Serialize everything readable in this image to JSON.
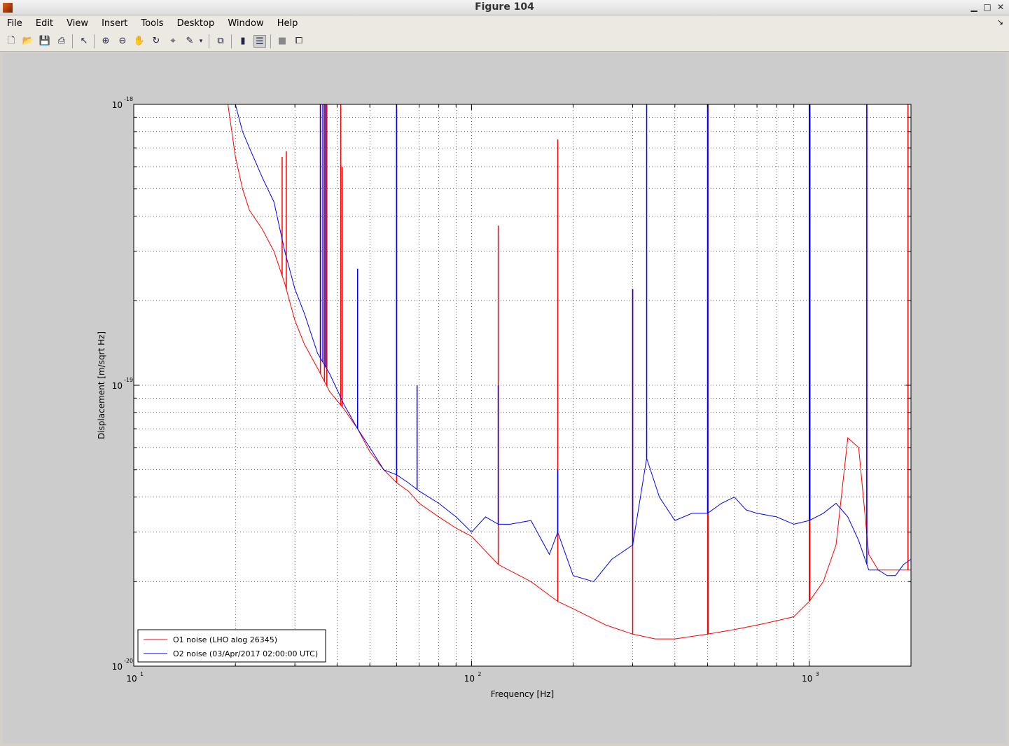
{
  "window": {
    "title": "Figure 104"
  },
  "menu": [
    "File",
    "Edit",
    "View",
    "Insert",
    "Tools",
    "Desktop",
    "Window",
    "Help"
  ],
  "toolbar": {
    "icons": [
      "new-figure-icon",
      "open-file-icon",
      "save-icon",
      "print-icon",
      "edit-plot-icon",
      "zoom-in-icon",
      "zoom-out-icon",
      "pan-icon",
      "rotate-icon",
      "data-cursor-icon",
      "brush-icon",
      "link-plot-icon",
      "colorbar-icon",
      "legend-icon",
      "hide-plot-tools-icon",
      "show-plot-tools-icon"
    ]
  },
  "chart_data": {
    "type": "line",
    "xlabel": "Frequency [Hz]",
    "ylabel": "Displacement [m/sqrt Hz]",
    "xscale": "log",
    "yscale": "log",
    "xlim": [
      10,
      2000
    ],
    "ylim": [
      1e-20,
      1e-18
    ],
    "grid": true,
    "legend_position": "bottom-left",
    "x_ticks": [
      {
        "value": 10,
        "base": "10",
        "exp": "1"
      },
      {
        "value": 100,
        "base": "10",
        "exp": "2"
      },
      {
        "value": 1000,
        "base": "10",
        "exp": "3"
      }
    ],
    "y_ticks": [
      {
        "value": 1e-20,
        "base": "10",
        "exp": "-20"
      },
      {
        "value": 1e-19,
        "base": "10",
        "exp": "-19"
      },
      {
        "value": 1e-18,
        "base": "10",
        "exp": "-18"
      }
    ],
    "series": [
      {
        "name": "O1 noise (LHO alog 26345)",
        "color": "#ff0000",
        "x": [
          19,
          20,
          21,
          22,
          24,
          26,
          28,
          30,
          32,
          35,
          38,
          42,
          46,
          50,
          55,
          60,
          65,
          70,
          80,
          90,
          100,
          120,
          150,
          180,
          200,
          250,
          300,
          350,
          400,
          500,
          600,
          700,
          800,
          900,
          1000,
          1100,
          1200,
          1300,
          1400,
          1500,
          1600,
          1700,
          1800,
          1900,
          2000
        ],
        "y": [
          1e-18,
          6.5e-19,
          5e-19,
          4.2e-19,
          3.6e-19,
          3e-19,
          2.3e-19,
          1.7e-19,
          1.4e-19,
          1.15e-19,
          9.5e-20,
          8.2e-20,
          7e-20,
          5.8e-20,
          5e-20,
          4.5e-20,
          4.2e-20,
          3.8e-20,
          3.4e-20,
          3.1e-20,
          2.9e-20,
          2.3e-20,
          2e-20,
          1.7e-20,
          1.6e-20,
          1.4e-20,
          1.3e-20,
          1.25e-20,
          1.25e-20,
          1.3e-20,
          1.35e-20,
          1.4e-20,
          1.45e-20,
          1.5e-20,
          1.7e-20,
          2e-20,
          2.7e-20,
          6.5e-20,
          6e-20,
          2.5e-20,
          2.2e-20,
          2.2e-20,
          2.2e-20,
          2.2e-20,
          2.2e-20
        ],
        "peaks": [
          {
            "f": 27.5,
            "top": 6.5e-19
          },
          {
            "f": 28.3,
            "top": 6.8e-19
          },
          {
            "f": 35.7,
            "top": 1e-18
          },
          {
            "f": 36.7,
            "top": 1e-18
          },
          {
            "f": 37.3,
            "top": 1e-18
          },
          {
            "f": 41,
            "top": 1e-18
          },
          {
            "f": 41.4,
            "top": 6e-19
          },
          {
            "f": 60,
            "top": 1e-18
          },
          {
            "f": 120,
            "top": 3.7e-19
          },
          {
            "f": 180,
            "top": 7.5e-19
          },
          {
            "f": 300,
            "top": 2.2e-19
          },
          {
            "f": 500,
            "top": 1e-18
          },
          {
            "f": 502,
            "top": 1e-18
          },
          {
            "f": 1000,
            "top": 1e-18
          },
          {
            "f": 1004,
            "top": 1e-18
          },
          {
            "f": 1480,
            "top": 1e-18
          },
          {
            "f": 1960,
            "top": 1e-18
          }
        ]
      },
      {
        "name": "O2 noise (03/Apr/2017 02:00:00 UTC)",
        "color": "#0000ff",
        "x": [
          20,
          21,
          22,
          23,
          24,
          26,
          28,
          30,
          32,
          35,
          38,
          42,
          46,
          50,
          55,
          60,
          65,
          70,
          80,
          90,
          100,
          110,
          120,
          130,
          150,
          170,
          180,
          200,
          230,
          260,
          300,
          330,
          360,
          400,
          450,
          500,
          550,
          600,
          650,
          700,
          800,
          900,
          1000,
          1100,
          1200,
          1300,
          1400,
          1500,
          1600,
          1700,
          1800,
          1900,
          2000
        ],
        "y": [
          1e-18,
          8e-19,
          7e-19,
          6.2e-19,
          5.5e-19,
          4.5e-19,
          3e-19,
          2.2e-19,
          1.8e-19,
          1.3e-19,
          1.1e-19,
          8.5e-20,
          7e-20,
          6e-20,
          5e-20,
          4.8e-20,
          4.5e-20,
          4.2e-20,
          3.8e-20,
          3.4e-20,
          3e-20,
          3.4e-20,
          3.2e-20,
          3.2e-20,
          3.3e-20,
          2.5e-20,
          3e-20,
          2.1e-20,
          2e-20,
          2.4e-20,
          2.7e-20,
          5.5e-20,
          4e-20,
          3.3e-20,
          3.5e-20,
          3.5e-20,
          3.8e-20,
          4e-20,
          3.6e-20,
          3.5e-20,
          3.4e-20,
          3.2e-20,
          3.3e-20,
          3.5e-20,
          3.8e-20,
          3.4e-20,
          2.8e-20,
          2.2e-20,
          2.2e-20,
          2.1e-20,
          2.1e-20,
          2.3e-20,
          2.4e-20
        ],
        "peaks": [
          {
            "f": 35.7,
            "top": 1e-18
          },
          {
            "f": 36.3,
            "top": 1e-18
          },
          {
            "f": 37,
            "top": 1e-18
          },
          {
            "f": 46,
            "top": 2.6e-19
          },
          {
            "f": 60,
            "top": 1e-18
          },
          {
            "f": 69,
            "top": 1e-19
          },
          {
            "f": 120,
            "top": 1e-19
          },
          {
            "f": 180,
            "top": 5e-20
          },
          {
            "f": 300,
            "top": 2.2e-19
          },
          {
            "f": 330,
            "top": 1e-18
          },
          {
            "f": 500,
            "top": 1e-18
          },
          {
            "f": 1000,
            "top": 1e-18
          },
          {
            "f": 1004,
            "top": 1e-18
          },
          {
            "f": 1480,
            "top": 1e-18
          }
        ]
      }
    ]
  }
}
